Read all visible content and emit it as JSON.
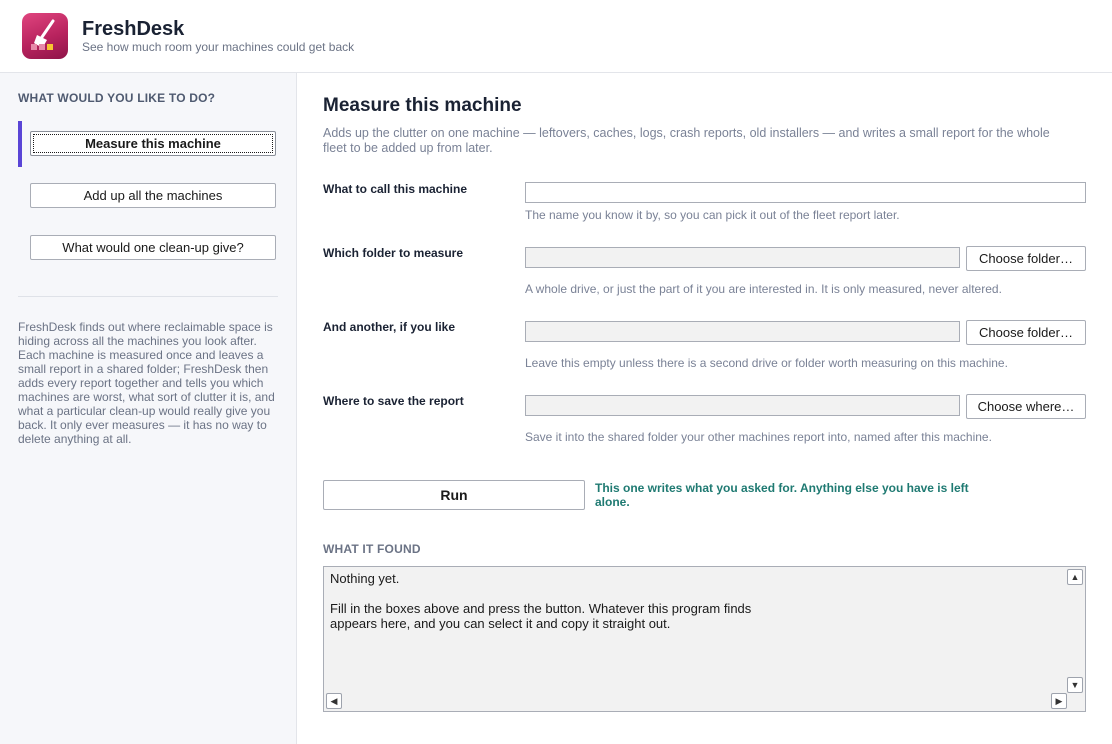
{
  "app": {
    "name": "FreshDesk",
    "tagline": "See how much room your machines could get back"
  },
  "sidebar": {
    "heading": "WHAT WOULD YOU LIKE TO DO?",
    "items": [
      {
        "label": "Measure this machine",
        "active": true
      },
      {
        "label": "Add up all the machines",
        "active": false
      },
      {
        "label": "What would one clean-up give?",
        "active": false
      }
    ],
    "description": "FreshDesk finds out where reclaimable space is hiding across all the machines you look after. Each machine is measured once and leaves a small report in a shared folder; FreshDesk then adds every report together and tells you which machines are worst, what sort of clutter it is, and what a particular clean-up would really give you back. It only ever measures — it has no way to delete anything at all."
  },
  "main": {
    "title": "Measure this machine",
    "description": "Adds up the clutter on one machine — leftovers, caches, logs, crash reports, old installers — and writes a small report for the whole fleet to be added up from later.",
    "fields": {
      "machine_name": {
        "label": "What to call this machine",
        "value": "",
        "hint": "The name you know it by, so you can pick it out of the fleet report later."
      },
      "folder": {
        "label": "Which folder to measure",
        "value": "",
        "button": "Choose folder…",
        "hint": "A whole drive, or just the part of it you are interested in. It is only measured, never altered."
      },
      "another_folder": {
        "label": "And another, if you like",
        "value": "",
        "button": "Choose folder…",
        "hint": "Leave this empty unless there is a second drive or folder worth measuring on this machine."
      },
      "report_location": {
        "label": "Where to save the report",
        "value": "",
        "button": "Choose where…",
        "hint": "Save it into the shared folder your other machines report into, named after this machine."
      }
    },
    "run_button": "Run",
    "run_note": "This one writes what you asked for. Anything else you have is left alone.",
    "output": {
      "heading": "WHAT IT FOUND",
      "text": "Nothing yet.\n\nFill in the boxes above and press the button. Whatever this program finds\nappears here, and you can select it and copy it straight out."
    }
  },
  "colors": {
    "accent": "#5a45d6",
    "note_teal": "#1f7a72",
    "icon_pink": "#c8306a"
  }
}
